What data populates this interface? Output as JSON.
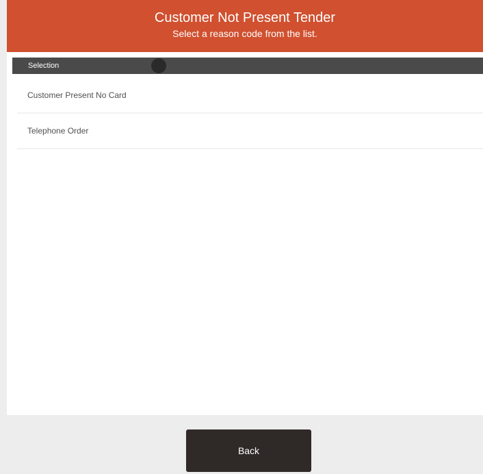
{
  "header": {
    "title": "Customer Not Present Tender",
    "subtitle": "Select a reason code from the list.",
    "background": "#d0502f"
  },
  "list": {
    "header_label": "Selection",
    "items": [
      {
        "label": "Customer Present No Card"
      },
      {
        "label": "Telephone Order"
      }
    ]
  },
  "footer": {
    "back_label": "Back",
    "button_color": "#2f2a28"
  }
}
